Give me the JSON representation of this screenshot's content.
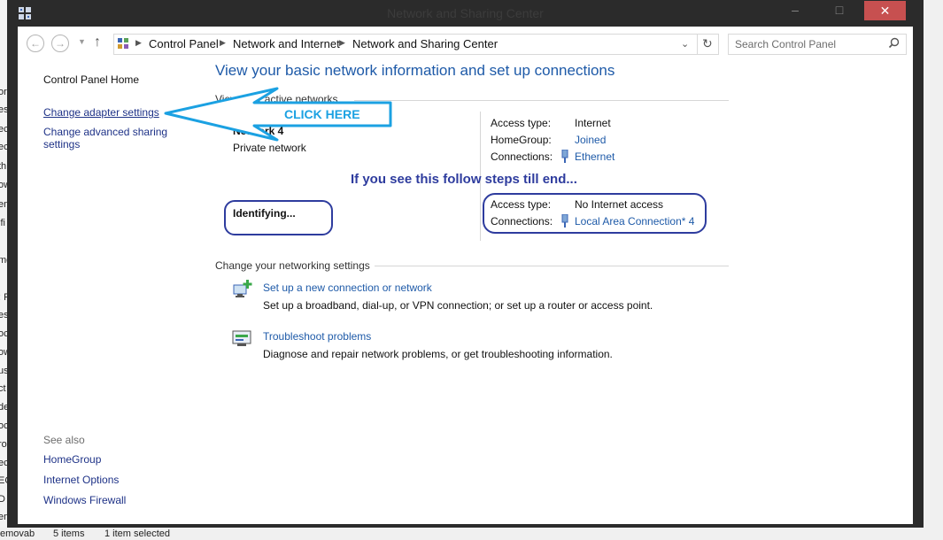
{
  "window": {
    "title": "Network and Sharing Center"
  },
  "address": {
    "crumbs": [
      "Control Panel",
      "Network and Internet",
      "Network and Sharing Center"
    ],
    "search_placeholder": "Search Control Panel"
  },
  "left_pane": {
    "home": "Control Panel Home",
    "adapter": "Change adapter settings",
    "advanced_line1": "Change advanced sharing",
    "advanced_line2": "settings",
    "see_also": "See also",
    "see_also_links": [
      "HomeGroup",
      "Internet Options",
      "Windows Firewall"
    ]
  },
  "main": {
    "title": "View your basic network information and set up connections",
    "active_networks_heading": "View your active networks",
    "network1": {
      "name": "Network 4",
      "type": "Private network",
      "access_label": "Access type:",
      "access_value": "Internet",
      "homegroup_label": "HomeGroup:",
      "homegroup_value": "Joined",
      "connections_label": "Connections:",
      "connections_value": "Ethernet"
    },
    "network2": {
      "name": "Identifying...",
      "access_label": "Access type:",
      "access_value": "No Internet access",
      "connections_label": "Connections:",
      "connections_value": "Local Area Connection* 4"
    },
    "change_settings_heading": "Change your networking settings",
    "tasks": [
      {
        "title": "Set up a new connection or network",
        "desc": "Set up a broadband, dial-up, or VPN connection; or set up a router or access point."
      },
      {
        "title": "Troubleshoot problems",
        "desc": "Diagnose and repair network problems, or get troubleshooting information."
      }
    ]
  },
  "annotations": {
    "click_here": "CLICK HERE",
    "note": "If you see this follow steps till end...",
    "color": "#2e3c9e",
    "arrow_color": "#1ba1e2"
  },
  "background": {
    "status_items": "5 items",
    "status_selected": "1 item selected",
    "side_fragments": [
      "ori",
      "esk",
      "ec",
      "ec",
      "th",
      "ow",
      "em",
      "ifi",
      "me",
      ": P",
      "esk",
      "oc",
      "ow",
      "us",
      "ct",
      "de",
      "oca",
      "rog",
      "ec",
      "EC",
      "D D",
      "em",
      "emovab"
    ]
  }
}
